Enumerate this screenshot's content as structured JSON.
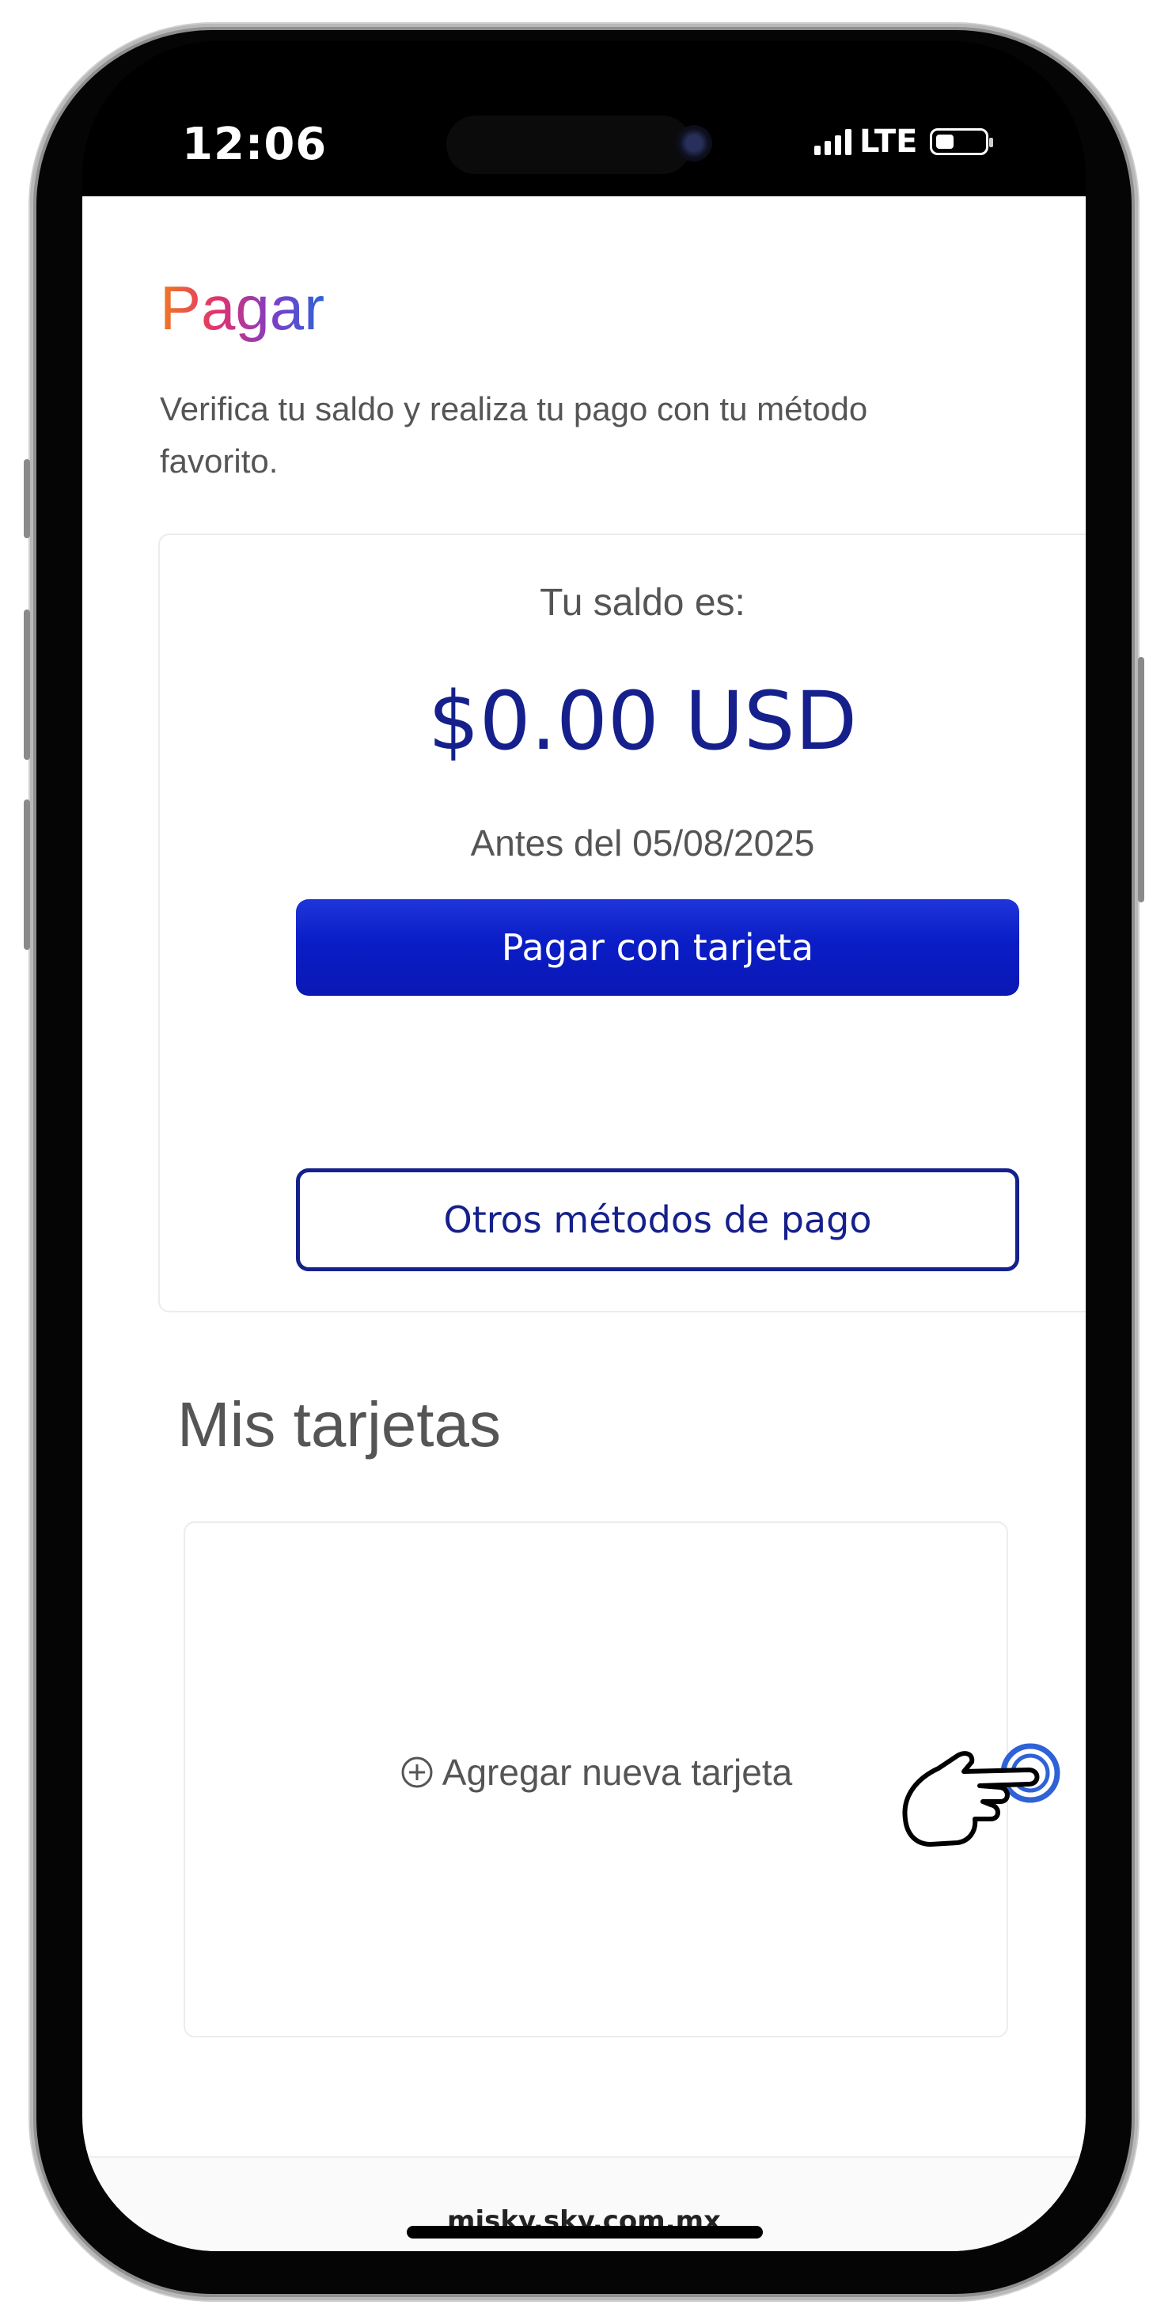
{
  "status_bar": {
    "time": "12:06",
    "network": "LTE",
    "icons": [
      "signal-icon",
      "battery-icon"
    ]
  },
  "page": {
    "title": "Pagar",
    "subtitle": "Verifica tu saldo y realiza tu pago con tu método favorito."
  },
  "balance": {
    "label": "Tu saldo es:",
    "amount": "$0.00 USD",
    "due": "Antes del 05/08/2025",
    "pay_button": "Pagar con tarjeta",
    "other_methods_button": "Otros métodos de pago"
  },
  "cards": {
    "title": "Mis tarjetas",
    "add_card_label": "Agregar nueva tarjeta",
    "add_icon": "plus-circle-icon",
    "pointer_icon": "hand-pointer-icon"
  },
  "browser": {
    "url": "misky.sky.com.mx"
  },
  "colors": {
    "primary": "#0a1dc6",
    "amount": "#15208c",
    "text_muted": "#555555"
  }
}
